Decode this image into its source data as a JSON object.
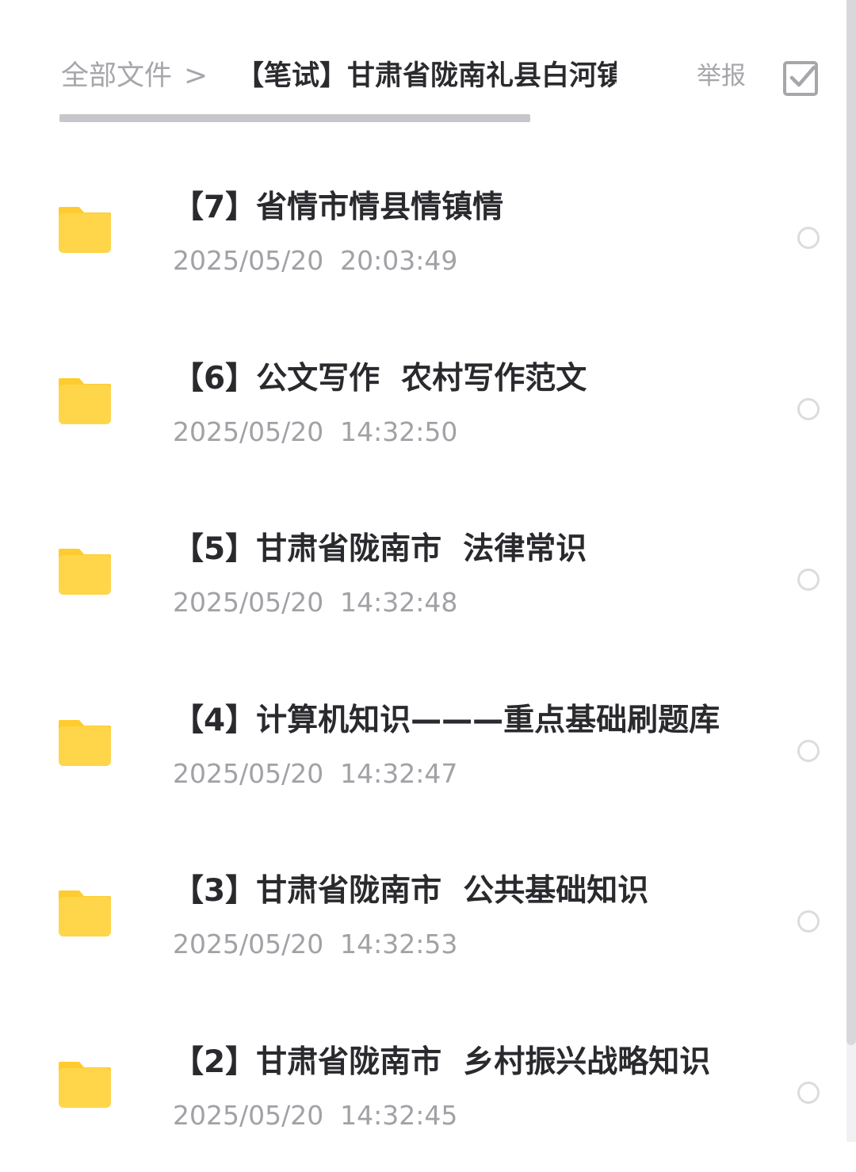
{
  "header": {
    "breadcrumb_root": "全部文件",
    "breadcrumb_separator": ">",
    "current_folder": "【笔试】甘肃省陇南礼县白河镇",
    "report_label": "举报",
    "select_icon": "checkbox-select-icon"
  },
  "colors": {
    "folder": "#ffd54a",
    "folder_tab": "#ffcb2e",
    "primary_text": "#2a2a2e",
    "secondary_text": "#a1a1a6"
  },
  "files": [
    {
      "name": "【7】省情市情县情镇情",
      "time": "2025/05/20  20:03:49",
      "icon": "folder-icon"
    },
    {
      "name": "【6】公文写作  农村写作范文",
      "time": "2025/05/20  14:32:50",
      "icon": "folder-icon"
    },
    {
      "name": "【5】甘肃省陇南市  法律常识",
      "time": "2025/05/20  14:32:48",
      "icon": "folder-icon"
    },
    {
      "name": "【4】计算机知识———重点基础刷题库",
      "time": "2025/05/20  14:32:47",
      "icon": "folder-icon"
    },
    {
      "name": "【3】甘肃省陇南市  公共基础知识",
      "time": "2025/05/20  14:32:53",
      "icon": "folder-icon"
    },
    {
      "name": "【2】甘肃省陇南市  乡村振兴战略知识",
      "time": "2025/05/20  14:32:45",
      "icon": "folder-icon"
    }
  ]
}
